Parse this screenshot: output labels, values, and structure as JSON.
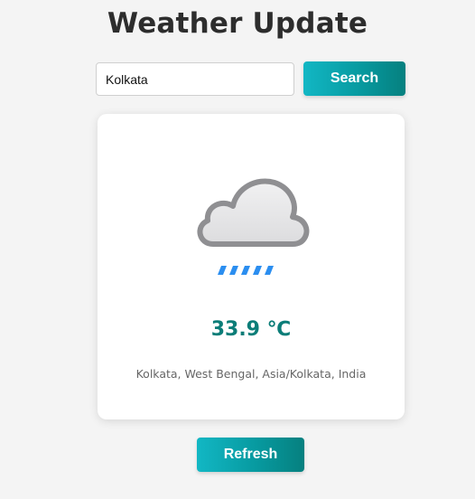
{
  "page": {
    "title": "Weather Update"
  },
  "search": {
    "value": "Kolkata",
    "button_label": "Search"
  },
  "weather": {
    "icon": "cloud-rain-icon",
    "temperature": "33.9 ℃",
    "location": "Kolkata, West Bengal, Asia/Kolkata, India"
  },
  "actions": {
    "refresh_label": "Refresh"
  },
  "colors": {
    "accent": "#079aa0",
    "temperature": "#0b7d78",
    "rain": "#2b8ef0"
  }
}
